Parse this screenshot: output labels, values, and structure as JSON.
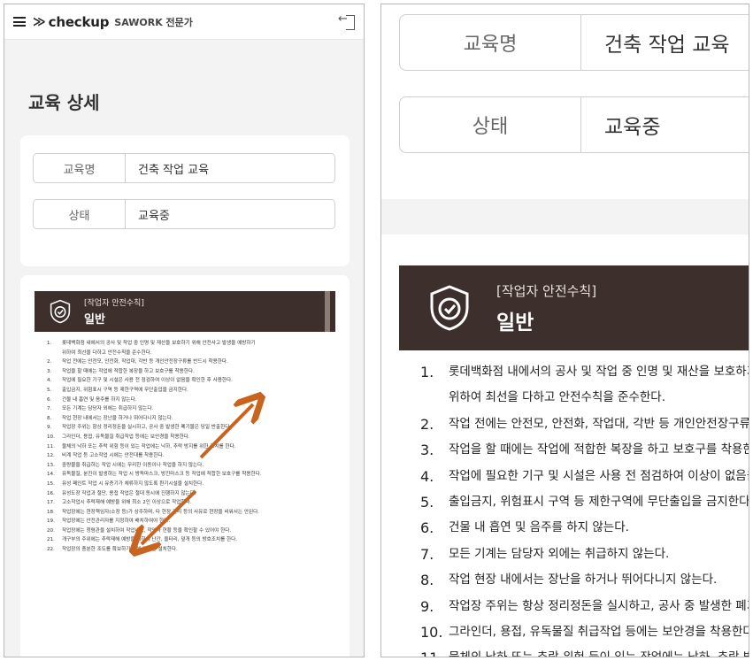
{
  "header": {
    "brand": "checkup",
    "brand_sub": "SAWORK 전문가"
  },
  "page_title": "교육 상세",
  "fields": [
    {
      "label": "교육명",
      "value": "건축 작업 교육"
    },
    {
      "label": "상태",
      "value": "교육중"
    }
  ],
  "banner": {
    "category": "[작업자 안전수칙]",
    "title": "일반"
  },
  "rules_left": [
    {
      "n": "1.",
      "t": "롯데백화점 내에서의 공사 및 작업 중 인명 및 재산을 보호하기 위해 안전사고 발생을 예방하기"
    },
    {
      "n": "",
      "t": "위하여 최선을 다하고 안전수칙을 준수한다."
    },
    {
      "n": "2.",
      "t": "작업 전에는 안전모, 안전화, 작업대, 각반 등 개인안전장구류를 반드시 착용한다."
    },
    {
      "n": "3.",
      "t": "작업을 할 때에는 작업에 적합한 복장을 하고 보호구를 착용한다."
    },
    {
      "n": "4.",
      "t": "작업에 필요한 기구 및 시설은 사용 전 점검하여 이상이 없음을 확인한 후 사용한다."
    },
    {
      "n": "5.",
      "t": "출입금지, 위험표시 구역 등 제한구역에 무단출입을 금지한다."
    },
    {
      "n": "6.",
      "t": "건물 내 흡연 및 음주를 하지 않는다."
    },
    {
      "n": "7.",
      "t": "모든 기계는 담당자 외에는 취급하지 않는다."
    },
    {
      "n": "8.",
      "t": "작업 현장 내에서는 장난을 하거나 뛰어다니지 않는다."
    },
    {
      "n": "9.",
      "t": "작업장 주위는 항상 정리정돈을 실시하고, 공사 중 발생한 폐기물은 당일 반출한다."
    },
    {
      "n": "10.",
      "t": "그라인더, 용접, 유독물질 취급작업 등에는 보안경을 착용한다."
    },
    {
      "n": "11.",
      "t": "물체의 낙하 또는 추락 위험 등이 있는 작업에는 낙하, 추락 방지를 위한 조치를 한다."
    },
    {
      "n": "12.",
      "t": "비계 작업 등 고소작업 시에는 안전대를 착용한다."
    },
    {
      "n": "13.",
      "t": "중량물을 취급하는 작업 시에는 무리한 이동이나 작업을 하지 않는다."
    },
    {
      "n": "14.",
      "t": "유독물질, 분진이 발생하는 작업 시 방독마스크, 방진마스크 등 작업에 적합한 보호구를 착용한다."
    },
    {
      "n": "15.",
      "t": "유성 페인트 작업 시 유증기가 체류하지 않도록 환기시설을 설치한다."
    },
    {
      "n": "16.",
      "t": "유성도장 작업과 절단, 용접 작업은 절대 동시에 진행하지 않는다."
    },
    {
      "n": "17.",
      "t": "고소작업시 추락재해 예방을 위해 최소 2인 이상으로 작업한다."
    },
    {
      "n": "18.",
      "t": "작업장에는 현장책임자(소장 등)가 상주하며, 타 현장 관리 등의 사유로 현장을 비워서는 안된다."
    },
    {
      "n": "19.",
      "t": "작업장에는 안전관리자를 지정하여 배치하여야 한다."
    },
    {
      "n": "20.",
      "t": "작업장에는 청렴관을 설치하여 작업내용, 작업자 현황 등을 확인할 수 있어야 한다."
    },
    {
      "n": "21.",
      "t": "개구부의 주위에는 추락재해 예방을 위하여 난간, 울타리, 덮개 등의 방호조치를 한다."
    },
    {
      "n": "22.",
      "t": "작업장의 충분한 조도를 확보하기 위해 조명을 설치한다."
    }
  ],
  "rules_right": [
    {
      "n": "1.",
      "t": "롯데백화점 내에서의 공사 및 작업 중 인명 및 재산을 보호하기"
    },
    {
      "n": "",
      "t": "위하여 최선을 다하고 안전수칙을 준수한다."
    },
    {
      "n": "2.",
      "t": "작업 전에는 안전모, 안전화, 작업대, 각반 등 개인안전장구류를"
    },
    {
      "n": "3.",
      "t": "작업을 할 때에는 작업에 적합한 복장을 하고 보호구를 착용한"
    },
    {
      "n": "4.",
      "t": "작업에 필요한 기구 및 시설은 사용 전 점검하여 이상이 없음을"
    },
    {
      "n": "5.",
      "t": "출입금지, 위험표시 구역 등 제한구역에 무단출입을 금지한다."
    },
    {
      "n": "6.",
      "t": "건물 내 흡연 및 음주를 하지 않는다."
    },
    {
      "n": "7.",
      "t": "모든 기계는 담당자 외에는 취급하지 않는다."
    },
    {
      "n": "8.",
      "t": "작업 현장 내에서는 장난을 하거나 뛰어다니지 않는다."
    },
    {
      "n": "9.",
      "t": "작업장 주위는 항상 정리정돈을 실시하고, 공사 중 발생한 폐기"
    },
    {
      "n": "10.",
      "t": "그라인더, 용접, 유독물질 취급작업 등에는 보안경을 착용한다"
    },
    {
      "n": "11.",
      "t": "물체의 낙하 또는 추락 위험 등이 있는 작업에는 낙하, 추락 방지"
    }
  ],
  "colors": {
    "banner": "#3c2f2c",
    "arrow": "#c8641e",
    "page_bg": "#f3f3f4"
  }
}
